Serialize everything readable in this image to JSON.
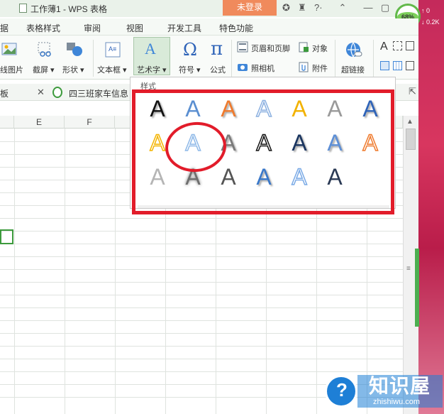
{
  "window": {
    "title": "工作薄1 - WPS 表格",
    "login_button": "未登录",
    "battery_percent": "68%",
    "net_up": "0",
    "net_down": "0.2K"
  },
  "menu": {
    "items": [
      "据",
      "表格样式",
      "审阅",
      "视图",
      "开发工具",
      "特色功能"
    ]
  },
  "ribbon": {
    "line_picture": "线图片",
    "screenshot": "截屏",
    "shapes": "形状",
    "textbox": "文本框",
    "arttext": "艺术字",
    "symbol": "符号",
    "formula": "公式",
    "header_footer": "页眉和页脚",
    "object": "对象",
    "camera": "照相机",
    "attachment": "附件",
    "hyperlink": "超链接",
    "symbol_glyph": "Ω",
    "formula_glyph": "π"
  },
  "tabs": {
    "left_fragment": "板",
    "doc_tab": "四三班家车信息"
  },
  "sheet": {
    "columns": [
      "E",
      "F"
    ]
  },
  "arttext_panel": {
    "label": "样式",
    "glyph": "A",
    "styles": [
      {
        "row": 1,
        "col": 1,
        "color": "#111111",
        "style": "black-shadow"
      },
      {
        "row": 1,
        "col": 2,
        "color": "#5b8fd1",
        "style": "blue-gradient"
      },
      {
        "row": 1,
        "col": 3,
        "color": "#ef7a2d",
        "style": "orange-shadow"
      },
      {
        "row": 1,
        "col": 4,
        "color": "#8bb0e0",
        "style": "blue-outline"
      },
      {
        "row": 1,
        "col": 5,
        "color": "#f2b200",
        "style": "gold"
      },
      {
        "row": 1,
        "col": 6,
        "color": "#9a9a9a",
        "style": "gray"
      },
      {
        "row": 1,
        "col": 7,
        "color": "#2e63b8",
        "style": "blue-reflect"
      },
      {
        "row": 2,
        "col": 1,
        "color": "#f4b400",
        "style": "gold-outline"
      },
      {
        "row": 2,
        "col": 2,
        "color": "#8fb9e8",
        "style": "light-blue-outline"
      },
      {
        "row": 2,
        "col": 3,
        "color": "#7a7a7a",
        "style": "gray-shadow"
      },
      {
        "row": 2,
        "col": 4,
        "color": "#111111",
        "style": "black-outline"
      },
      {
        "row": 2,
        "col": 5,
        "color": "#1a3560",
        "style": "navy-shadow"
      },
      {
        "row": 2,
        "col": 6,
        "color": "#5d8fd6",
        "style": "blue-3d"
      },
      {
        "row": 2,
        "col": 7,
        "color": "#ef7a2d",
        "style": "orange-outline"
      },
      {
        "row": 3,
        "col": 1,
        "color": "#b5b5b5",
        "style": "light-gray"
      },
      {
        "row": 3,
        "col": 2,
        "color": "#6e6e6e",
        "style": "gray-blur"
      },
      {
        "row": 3,
        "col": 3,
        "color": "#555555",
        "style": "dark-gray"
      },
      {
        "row": 3,
        "col": 4,
        "color": "#3a78c9",
        "style": "blue-gradient-3d"
      },
      {
        "row": 3,
        "col": 5,
        "color": "#7aaae6",
        "style": "blue-outline-light"
      },
      {
        "row": 3,
        "col": 6,
        "color": "#2b3a55",
        "style": "dark-striped"
      }
    ]
  },
  "watermark": {
    "text": "知识屋",
    "url": "zhishiwu.com"
  },
  "colors": {
    "highlight_red": "#e21c2a",
    "login_orange": "#f08a5c",
    "selection_green": "#3c9a3c",
    "side_panel_pink": "#c42a5b"
  }
}
